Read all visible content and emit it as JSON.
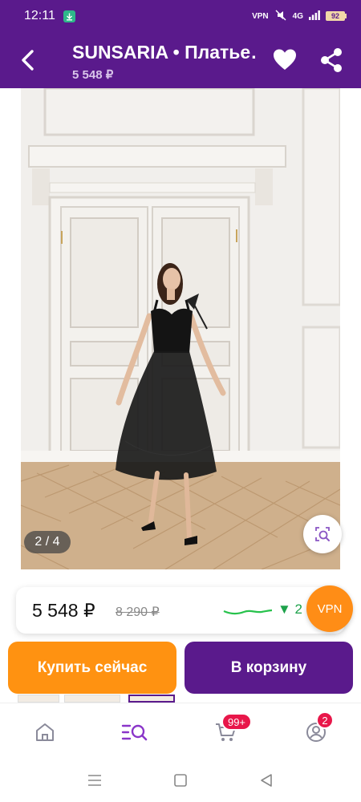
{
  "status_bar": {
    "time": "12:11",
    "vpn": "VPN",
    "network": "4G",
    "battery": "92"
  },
  "header": {
    "title": "SUNSARIA • Платье…",
    "price": "5 548 ₽"
  },
  "gallery": {
    "counter": "2 / 4"
  },
  "price_card": {
    "current": "5 548 ₽",
    "old": "8 290 ₽",
    "drop_text": "▼ 2"
  },
  "vpn_badge": "VPN",
  "actions": {
    "buy_now": "Купить сейчас",
    "add_to_cart": "В корзину"
  },
  "bottom_nav": {
    "items": [
      {
        "icon": "home-icon"
      },
      {
        "icon": "catalog-search-icon"
      },
      {
        "icon": "cart-icon",
        "badge": "99+"
      },
      {
        "icon": "profile-icon",
        "badge": "2"
      }
    ]
  },
  "colors": {
    "brand_purple": "#5a1a8c",
    "accent_orange": "#ff9211",
    "badge_red": "#e8174a",
    "price_drop_green": "#1ea24b"
  }
}
